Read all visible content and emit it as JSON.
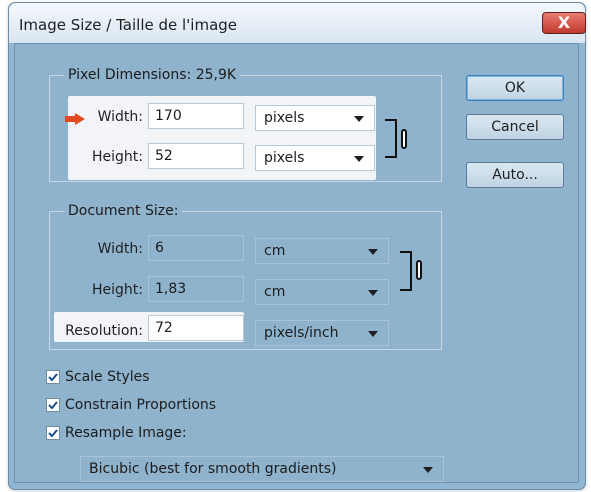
{
  "window": {
    "title": "Image Size  / Taille de l'image",
    "close_icon": "close-icon",
    "close_label": "X"
  },
  "buttons": {
    "ok": "OK",
    "cancel": "Cancel",
    "auto": "Auto..."
  },
  "pixel_dimensions": {
    "title": "Pixel Dimensions:  25,9K",
    "width_label": "Width:",
    "width_value": "170",
    "width_unit": "pixels",
    "height_label": "Height:",
    "height_value": "52",
    "height_unit": "pixels",
    "link_icon": "chain-link-icon",
    "pointer_icon": "red-arrow-icon",
    "highlight_color": "#f2f4f7",
    "arrow_color": "#e34a1f"
  },
  "document_size": {
    "title": "Document Size:",
    "width_label": "Width:",
    "width_value": "6",
    "width_unit": "cm",
    "height_label": "Height:",
    "height_value": "1,83",
    "height_unit": "cm",
    "resolution_label": "Resolution:",
    "resolution_value": "72",
    "resolution_unit": "pixels/inch",
    "link_icon": "chain-link-icon"
  },
  "options": {
    "scale_styles": {
      "label": "Scale Styles",
      "checked": true
    },
    "constrain_proportions": {
      "label": "Constrain Proportions",
      "checked": true
    },
    "resample_image": {
      "label": "Resample Image:",
      "checked": true
    },
    "resample_method": "Bicubic (best for smooth gradients)"
  }
}
